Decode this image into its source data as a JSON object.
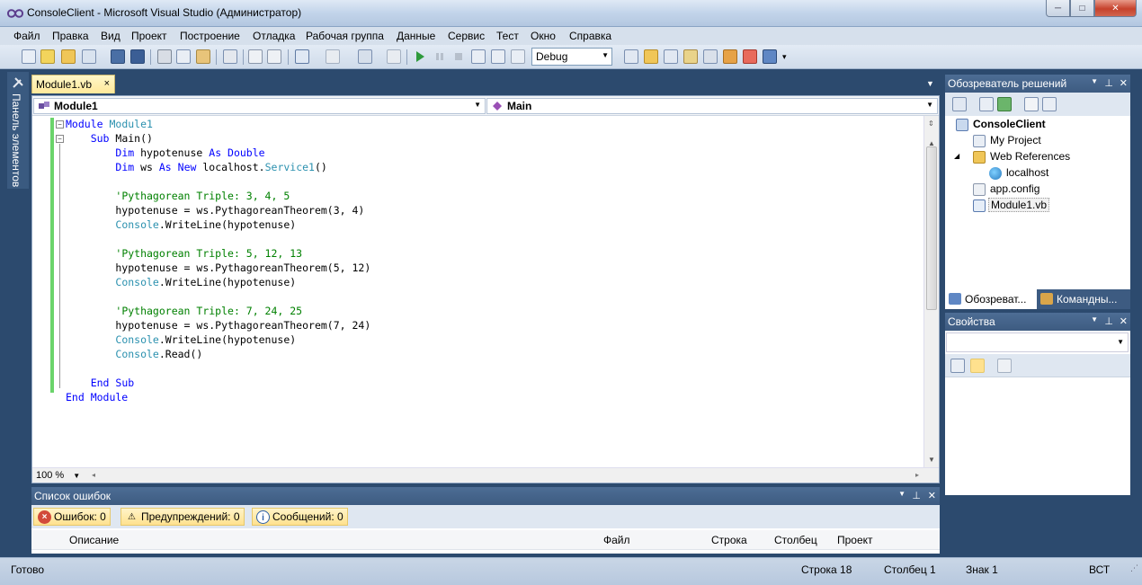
{
  "window": {
    "title": "ConsoleClient - Microsoft Visual Studio (Администратор)",
    "minimize": "─",
    "maximize": "□",
    "close": "✕"
  },
  "menu": {
    "items": [
      "Файл",
      "Правка",
      "Вид",
      "Проект",
      "Построение",
      "Отладка",
      "Рабочая группа",
      "Данные",
      "Сервис",
      "Тест",
      "Окно",
      "Справка"
    ]
  },
  "toolbar": {
    "config_value": "Debug"
  },
  "toolbox": {
    "label": "Панель элементов"
  },
  "editor": {
    "tab_label": "Module1.vb",
    "tab_close": "×",
    "class_combo": "Module1",
    "method_combo": "Main",
    "zoom": "100 %",
    "code_lines": [
      [
        {
          "c": "kw",
          "t": "Module "
        },
        {
          "c": "ty",
          "t": "Module1"
        }
      ],
      [
        {
          "c": "tx",
          "t": "    "
        },
        {
          "c": "kw",
          "t": "Sub "
        },
        {
          "c": "tx",
          "t": "Main()"
        }
      ],
      [
        {
          "c": "tx",
          "t": "        "
        },
        {
          "c": "kw",
          "t": "Dim "
        },
        {
          "c": "tx",
          "t": "hypotenuse "
        },
        {
          "c": "kw",
          "t": "As Double"
        }
      ],
      [
        {
          "c": "tx",
          "t": "        "
        },
        {
          "c": "kw",
          "t": "Dim "
        },
        {
          "c": "tx",
          "t": "ws "
        },
        {
          "c": "kw",
          "t": "As New "
        },
        {
          "c": "tx",
          "t": "localhost."
        },
        {
          "c": "ty",
          "t": "Service1"
        },
        {
          "c": "tx",
          "t": "()"
        }
      ],
      [],
      [
        {
          "c": "tx",
          "t": "        "
        },
        {
          "c": "cm",
          "t": "'Pythagorean Triple: 3, 4, 5"
        }
      ],
      [
        {
          "c": "tx",
          "t": "        hypotenuse = ws.PythagoreanTheorem(3, 4)"
        }
      ],
      [
        {
          "c": "tx",
          "t": "        "
        },
        {
          "c": "ty",
          "t": "Console"
        },
        {
          "c": "tx",
          "t": ".WriteLine(hypotenuse)"
        }
      ],
      [],
      [
        {
          "c": "tx",
          "t": "        "
        },
        {
          "c": "cm",
          "t": "'Pythagorean Triple: 5, 12, 13"
        }
      ],
      [
        {
          "c": "tx",
          "t": "        hypotenuse = ws.PythagoreanTheorem(5, 12)"
        }
      ],
      [
        {
          "c": "tx",
          "t": "        "
        },
        {
          "c": "ty",
          "t": "Console"
        },
        {
          "c": "tx",
          "t": ".WriteLine(hypotenuse)"
        }
      ],
      [],
      [
        {
          "c": "tx",
          "t": "        "
        },
        {
          "c": "cm",
          "t": "'Pythagorean Triple: 7, 24, 25"
        }
      ],
      [
        {
          "c": "tx",
          "t": "        hypotenuse = ws.PythagoreanTheorem(7, 24)"
        }
      ],
      [
        {
          "c": "tx",
          "t": "        "
        },
        {
          "c": "ty",
          "t": "Console"
        },
        {
          "c": "tx",
          "t": ".WriteLine(hypotenuse)"
        }
      ],
      [
        {
          "c": "tx",
          "t": "        "
        },
        {
          "c": "ty",
          "t": "Console"
        },
        {
          "c": "tx",
          "t": ".Read()"
        }
      ],
      [],
      [
        {
          "c": "tx",
          "t": "    "
        },
        {
          "c": "kw",
          "t": "End Sub"
        }
      ],
      [
        {
          "c": "kw",
          "t": "End Module"
        }
      ]
    ]
  },
  "error_list": {
    "title": "Список ошибок",
    "errors_label": "Ошибок: 0",
    "warnings_label": "Предупреждений: 0",
    "messages_label": "Сообщений: 0",
    "columns": [
      "Описание",
      "Файл",
      "Строка",
      "Столбец",
      "Проект"
    ]
  },
  "solution_explorer": {
    "title": "Обозреватель решений",
    "root": "ConsoleClient",
    "items": [
      "My Project",
      "Web References",
      "localhost",
      "app.config",
      "Module1.vb"
    ],
    "tabs": [
      "Обозреват...",
      "Командны..."
    ]
  },
  "properties": {
    "title": "Свойства"
  },
  "status": {
    "ready": "Готово",
    "line": "Строка 18",
    "column": "Столбец 1",
    "char": "Знак 1",
    "mode": "ВСТ"
  }
}
